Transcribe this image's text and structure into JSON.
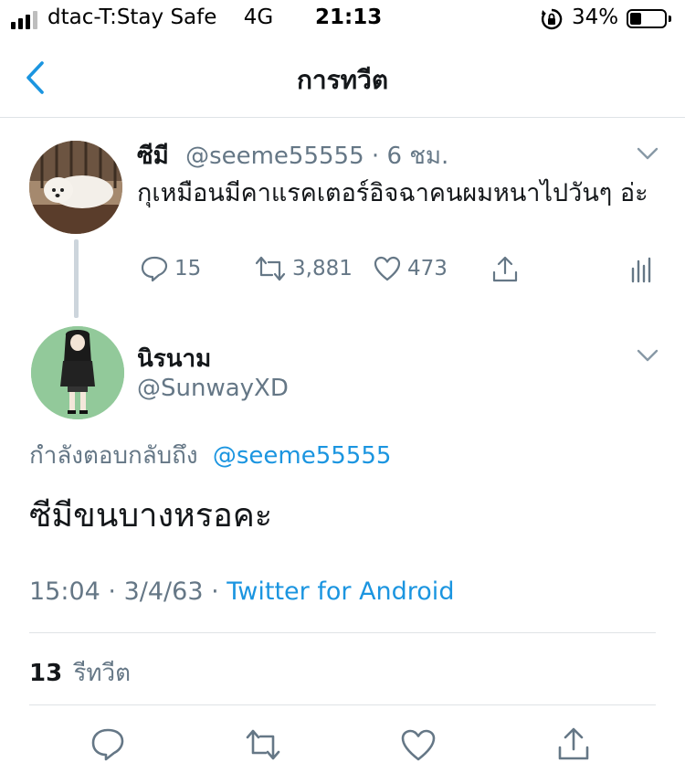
{
  "status_bar": {
    "carrier": "dtac-T:Stay Safe",
    "network": "4G",
    "time": "21:13",
    "battery_percent": "34%",
    "battery_level": 0.34
  },
  "nav": {
    "title": "การทวีต",
    "back_icon": "chevron-left-icon"
  },
  "parent_tweet": {
    "name": "ซีมี",
    "handle": "@seeme55555",
    "time": "6 ชม.",
    "separator": "·",
    "text": "กุเหมือนมีคาแรคเตอร์อิจฉาคนผมหนาไปวันๆ อ่ะ",
    "replies": "15",
    "retweets": "3,881",
    "likes": "473"
  },
  "reply_tweet": {
    "name": "นิรนาม",
    "handle": "@SunwayXD",
    "replying_label": "กำลังตอบกลับถึง",
    "replying_to": "@seeme55555",
    "text": "ซีมีขนบางหรอคะ",
    "time": "15:04",
    "date": "3/4/63",
    "sep1": "·",
    "sep2": "·",
    "source": "Twitter for Android",
    "retweet_count": "13",
    "retweet_label": "รีทวีต"
  },
  "colors": {
    "link": "#1b95e0",
    "muted": "#657786",
    "text": "#14171a",
    "divider": "#dfe3e6"
  }
}
